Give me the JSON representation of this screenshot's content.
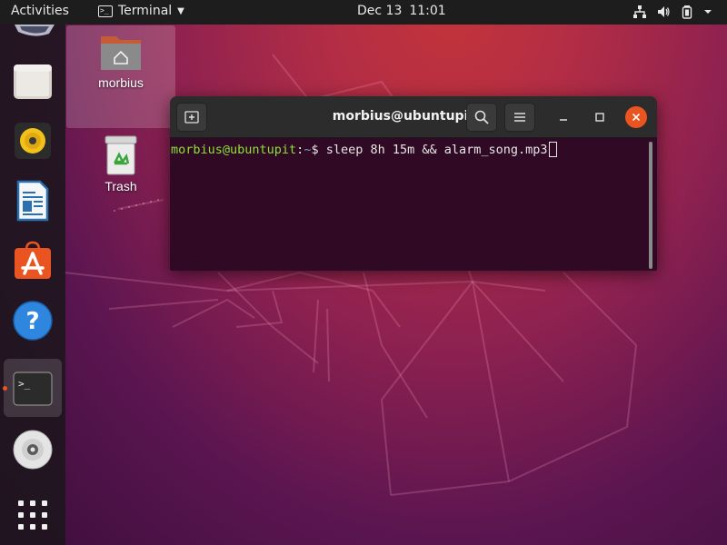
{
  "topbar": {
    "activities": "Activities",
    "app_menu_label": "Terminal",
    "clock_date": "Dec 13",
    "clock_time": "11:01",
    "tray_icons": [
      "network-icon",
      "volume-icon",
      "battery-icon",
      "chevron-down-icon"
    ]
  },
  "dock": {
    "items": [
      {
        "name": "files",
        "icon": "folder-icon"
      },
      {
        "name": "rhythmbox",
        "icon": "speaker-icon"
      },
      {
        "name": "libreoffice-writer",
        "icon": "document-icon"
      },
      {
        "name": "ubuntu-software",
        "icon": "shopping-bag-icon"
      },
      {
        "name": "help",
        "icon": "help-icon"
      },
      {
        "name": "terminal",
        "icon": "terminal-icon",
        "active": true
      },
      {
        "name": "dvd",
        "icon": "disc-icon"
      },
      {
        "name": "show-applications",
        "icon": "app-grid-icon"
      }
    ]
  },
  "desktop": {
    "home_label": "morbius",
    "trash_label": "Trash"
  },
  "terminal": {
    "title": "morbius@ubuntupit: ~",
    "prompt_user": "morbius@ubuntupit",
    "prompt_sep": ":",
    "prompt_path": "~",
    "prompt_symbol": "$ ",
    "command": "sleep 8h 15m && alarm_song.mp3"
  },
  "colors": {
    "accent": "#e95420",
    "terminal_bg": "#300a24",
    "prompt_user": "#8ae234",
    "prompt_path": "#729fcf"
  }
}
